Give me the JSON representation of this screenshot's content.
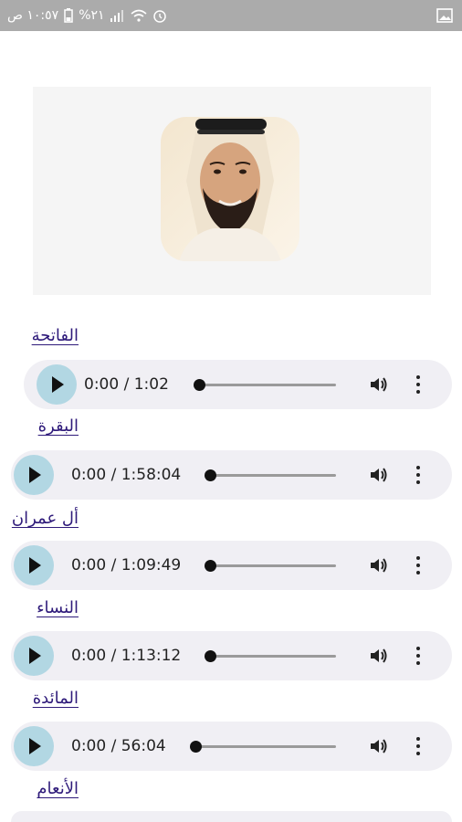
{
  "status_bar": {
    "time": "١٠:٥٧ ص",
    "battery": "%٢١",
    "icons": [
      "alarm-icon",
      "wifi-icon",
      "signal-icon",
      "battery-icon",
      "image-icon"
    ]
  },
  "reciter_image_alt": "reciter-portrait",
  "tracks": [
    {
      "title": "الفاتحة",
      "current": "0:00",
      "duration": "1:02",
      "time_text": "0:00 / 1:02"
    },
    {
      "title": "البقرة",
      "current": "0:00",
      "duration": "1:58:04",
      "time_text": "0:00 / 1:58:04"
    },
    {
      "title": "أل عمران",
      "current": "0:00",
      "duration": "1:09:49",
      "time_text": "0:00 / 1:09:49"
    },
    {
      "title": "النساء",
      "current": "0:00",
      "duration": "1:13:12",
      "time_text": "0:00 / 1:13:12"
    },
    {
      "title": "المائدة",
      "current": "0:00",
      "duration": "56:04",
      "time_text": "0:00 / 56:04"
    },
    {
      "title": "الأنعام",
      "current": "",
      "duration": "",
      "time_text": ""
    }
  ]
}
